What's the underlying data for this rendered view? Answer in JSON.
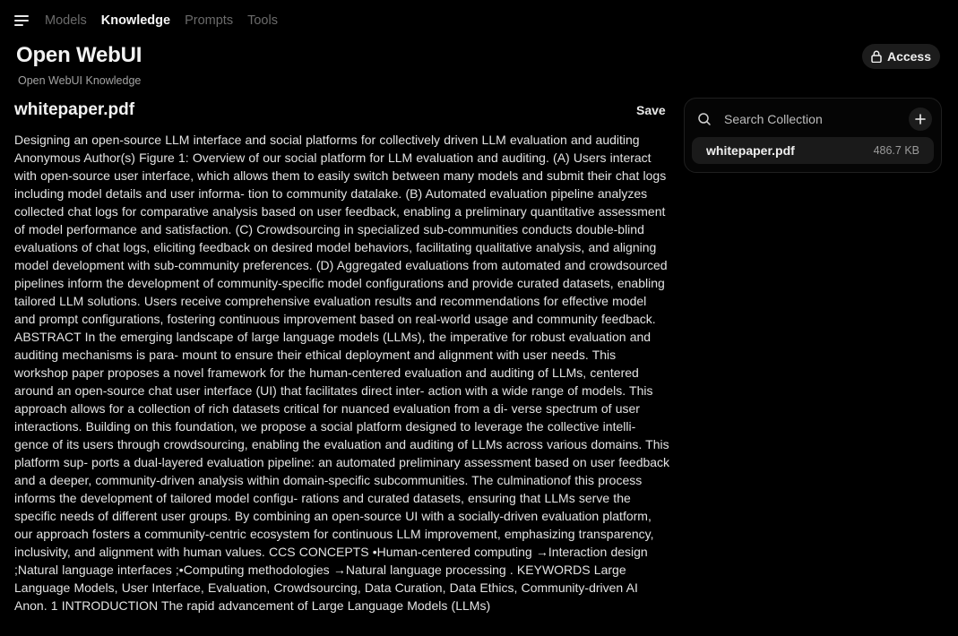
{
  "nav": {
    "tabs": [
      {
        "label": "Models",
        "active": false
      },
      {
        "label": "Knowledge",
        "active": true
      },
      {
        "label": "Prompts",
        "active": false
      },
      {
        "label": "Tools",
        "active": false
      }
    ]
  },
  "header": {
    "title": "Open WebUI",
    "subtitle": "Open WebUI Knowledge",
    "access_label": "Access"
  },
  "document": {
    "title": "whitepaper.pdf",
    "save_label": "Save",
    "content": "Designing an open-source LLM interface and social platforms for collectively driven LLM evaluation and auditing Anonymous Author(s) Figure 1: Overview of our social platform for LLM evaluation and auditing. (A) Users interact with open-source user interface, which allows them to easily switch between many models and submit their chat logs including model details and user informa- tion to community datalake. (B) Automated evaluation pipeline analyzes collected chat logs for comparative analysis based on user feedback, enabling a preliminary quantitative assessment of model performance and satisfaction. (C) Crowdsourcing in specialized sub-communities conducts double-blind evaluations of chat logs, eliciting feedback on desired model behaviors, facilitating qualitative analysis, and aligning model development with sub-community preferences. (D) Aggregated evaluations from automated and crowdsourced pipelines inform the development of community-specific model configurations and provide curated datasets, enabling tailored LLM solutions. Users receive comprehensive evaluation results and recommendations for effective model and prompt configurations, fostering continuous improvement based on real-world usage and community feedback. ABSTRACT In the emerging landscape of large language models (LLMs), the imperative for robust evaluation and auditing mechanisms is para- mount to ensure their ethical deployment and alignment with user needs. This workshop paper proposes a novel framework for the human-centered evaluation and auditing of LLMs, centered around an open-source chat user interface (UI) that facilitates direct inter- action with a wide range of models. This approach allows for a collection of rich datasets critical for nuanced evaluation from a di- verse spectrum of user interactions. Building on this foundation, we propose a social platform designed to leverage the collective intelli- gence of its users through crowdsourcing, enabling the evaluation and auditing of LLMs across various domains. This platform sup- ports a dual-layered evaluation pipeline: an automated preliminary assessment based on user feedback and a deeper, community-driven analysis within domain-specific subcommunities. The culminationof this process informs the development of tailored model configu- rations and curated datasets, ensuring that LLMs serve the specific needs of different user groups. By combining an open-source UI with a socially-driven evaluation platform, our approach fosters a community-centric ecosystem for continuous LLM improvement, emphasizing transparency, inclusivity, and alignment with human values. CCS CONCEPTS •Human-centered computing →Interaction design ;Natural language interfaces ;•Computing methodologies →Natural language processing . KEYWORDS Large Language Models, User Interface, Evaluation, Crowdsourcing, Data Curation, Data Ethics, Community-driven AI Anon. 1 INTRODUCTION The rapid advancement of Large Language Models (LLMs)"
  },
  "collection": {
    "search_placeholder": "Search Collection",
    "files": [
      {
        "name": "whitepaper.pdf",
        "size": "486.7 KB"
      }
    ]
  },
  "icons": {
    "menu": "hamburger-menu-icon",
    "lock": "lock-icon",
    "search": "search-icon",
    "add": "plus-icon"
  }
}
